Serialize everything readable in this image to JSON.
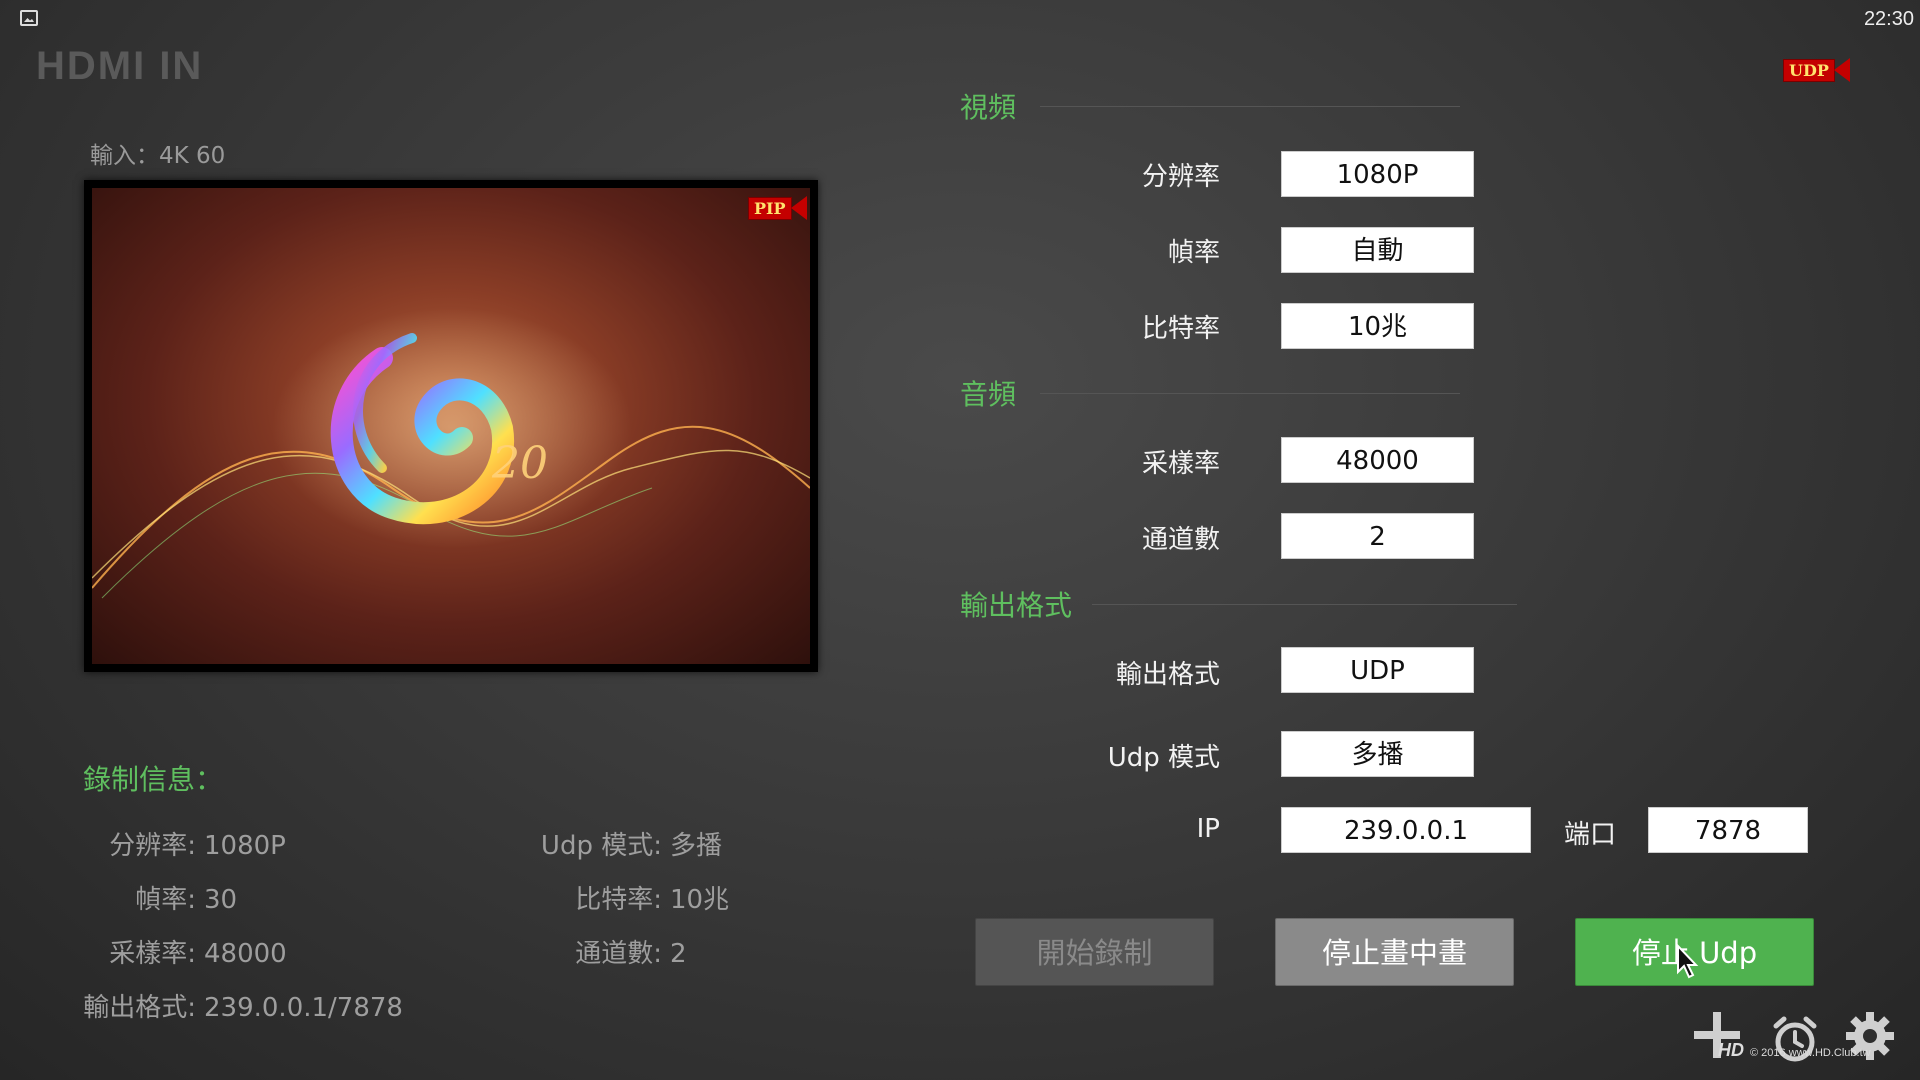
{
  "status_bar": {
    "time": "22:30"
  },
  "app_title": "HDMI IN",
  "udp_badge": "UDP",
  "pip_badge": "PIP",
  "input_info": "輸入：4K   60",
  "record_info": {
    "title": "錄制信息：",
    "resolution": {
      "label": "分辨率:",
      "value": "1080P"
    },
    "frame_rate": {
      "label": "幀率:",
      "value": "30"
    },
    "sample_rate": {
      "label": "采樣率:",
      "value": "48000"
    },
    "output_format": {
      "label": "輸出格式:",
      "value": "239.0.0.1/7878"
    },
    "udp_mode": {
      "label": "Udp 模式:",
      "value": "多播"
    },
    "bitrate": {
      "label": "比特率:",
      "value": "10兆"
    },
    "channels": {
      "label": "通道數:",
      "value": "2"
    }
  },
  "video_section": {
    "title": "視頻",
    "resolution": {
      "label": "分辨率",
      "value": "1080P"
    },
    "frame_rate": {
      "label": "幀率",
      "value": "自動"
    },
    "bitrate": {
      "label": "比特率",
      "value": "10兆"
    }
  },
  "audio_section": {
    "title": "音頻",
    "sample_rate": {
      "label": "采樣率",
      "value": "48000"
    },
    "channels": {
      "label": "通道數",
      "value": "2"
    }
  },
  "output_section": {
    "title": "輸出格式",
    "format": {
      "label": "輸出格式",
      "value": "UDP"
    },
    "udp_mode": {
      "label": "Udp 模式",
      "value": "多播"
    },
    "ip": {
      "label": "IP",
      "value": "239.0.0.1"
    },
    "port": {
      "label": "端口",
      "value": "7878"
    }
  },
  "buttons": {
    "start_record": "開始錄制",
    "stop_pip": "停止畫中畫",
    "stop_udp": "停止 Udp"
  },
  "watermark": {
    "logo": "HD",
    "text": "© 2016  www.HD.Club.tw"
  },
  "colors": {
    "accent_green": "#5fbf5f",
    "button_green": "#4fb24f",
    "badge_red": "#c40000"
  }
}
